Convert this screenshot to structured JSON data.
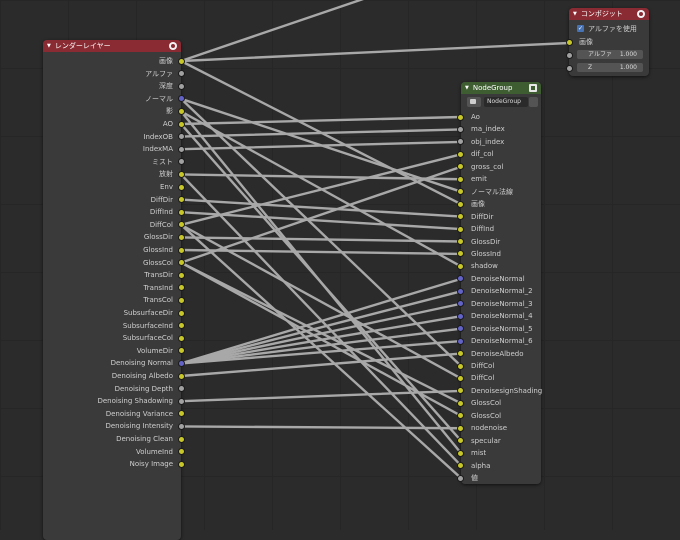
{
  "render_layers": {
    "title": "レンダーレイヤー",
    "outputs": [
      {
        "label": "画像",
        "c": "y"
      },
      {
        "label": "アルファ",
        "c": "g"
      },
      {
        "label": "深度",
        "c": "g"
      },
      {
        "label": "ノーマル",
        "c": "b"
      },
      {
        "label": "影",
        "c": "y"
      },
      {
        "label": "AO",
        "c": "y"
      },
      {
        "label": "IndexOB",
        "c": "g"
      },
      {
        "label": "IndexMA",
        "c": "g"
      },
      {
        "label": "ミスト",
        "c": "g"
      },
      {
        "label": "放射",
        "c": "y"
      },
      {
        "label": "Env",
        "c": "y"
      },
      {
        "label": "DiffDir",
        "c": "y"
      },
      {
        "label": "DiffInd",
        "c": "y"
      },
      {
        "label": "DiffCol",
        "c": "y"
      },
      {
        "label": "GlossDir",
        "c": "y"
      },
      {
        "label": "GlossInd",
        "c": "y"
      },
      {
        "label": "GlossCol",
        "c": "y"
      },
      {
        "label": "TransDir",
        "c": "y"
      },
      {
        "label": "TransInd",
        "c": "y"
      },
      {
        "label": "TransCol",
        "c": "y"
      },
      {
        "label": "SubsurfaceDir",
        "c": "y"
      },
      {
        "label": "SubsurfaceInd",
        "c": "y"
      },
      {
        "label": "SubsurfaceCol",
        "c": "y"
      },
      {
        "label": "VolumeDir",
        "c": "y"
      },
      {
        "label": "Denoising Normal",
        "c": "b"
      },
      {
        "label": "Denoising Albedo",
        "c": "y"
      },
      {
        "label": "Denoising Depth",
        "c": "g"
      },
      {
        "label": "Denoising Shadowing",
        "c": "g"
      },
      {
        "label": "Denoising Variance",
        "c": "y"
      },
      {
        "label": "Denoising Intensity",
        "c": "g"
      },
      {
        "label": "Denoising Clean",
        "c": "y"
      },
      {
        "label": "VolumeInd",
        "c": "y"
      },
      {
        "label": "Noisy Image",
        "c": "y"
      }
    ]
  },
  "composite": {
    "title": "コンポジット",
    "use_alpha_label": "アルファを使用",
    "image_label": "画像",
    "alpha_label": "アルファ",
    "alpha_value": "1.000",
    "z_label": "Z",
    "z_value": "1.000"
  },
  "node_group": {
    "title": "NodeGroup",
    "group_name": "NodeGroup",
    "inputs": [
      {
        "label": "Ao",
        "c": "y"
      },
      {
        "label": "ma_index",
        "c": "g"
      },
      {
        "label": "obj_index",
        "c": "g"
      },
      {
        "label": "dif_col",
        "c": "y"
      },
      {
        "label": "gross_col",
        "c": "y"
      },
      {
        "label": "emit",
        "c": "y"
      },
      {
        "label": "ノーマル法線",
        "c": "y"
      },
      {
        "label": "画像",
        "c": "y"
      },
      {
        "label": "DiffDir",
        "c": "y"
      },
      {
        "label": "DiffInd",
        "c": "y"
      },
      {
        "label": "GlossDir",
        "c": "y"
      },
      {
        "label": "GlossInd",
        "c": "y"
      },
      {
        "label": "shadow",
        "c": "y"
      },
      {
        "label": "DenoiseNormal",
        "c": "b"
      },
      {
        "label": "DenoiseNormal_2",
        "c": "b"
      },
      {
        "label": "DenoiseNormal_3",
        "c": "b"
      },
      {
        "label": "DenoiseNormal_4",
        "c": "b"
      },
      {
        "label": "DenoiseNormal_5",
        "c": "b"
      },
      {
        "label": "DenoiseNormal_6",
        "c": "b"
      },
      {
        "label": "DenoiseAlbedo",
        "c": "y"
      },
      {
        "label": "DiffCol",
        "c": "y"
      },
      {
        "label": "DiffCol",
        "c": "y"
      },
      {
        "label": "DenoisesignShading",
        "c": "y"
      },
      {
        "label": "GlossCol",
        "c": "y"
      },
      {
        "label": "GlossCol",
        "c": "y"
      },
      {
        "label": "nodenoise",
        "c": "y"
      },
      {
        "label": "specular",
        "c": "y"
      },
      {
        "label": "mist",
        "c": "y"
      },
      {
        "label": "alpha",
        "c": "y"
      },
      {
        "label": "値",
        "c": "g"
      }
    ]
  },
  "colors": {
    "background": "#2b2b2b",
    "link": "#a8a8a8",
    "socket_color": "#c7c729",
    "socket_gray": "#a1a1a1",
    "socket_vector": "#6363c7",
    "output_header": "#8a2b33",
    "group_header": "#3e5e32"
  },
  "links": [
    [
      0,
      7
    ],
    [
      0,
      "c0"
    ],
    [
      0,
      "up"
    ],
    [
      3,
      6
    ],
    [
      4,
      12
    ],
    [
      4,
      27
    ],
    [
      5,
      0
    ],
    [
      6,
      1
    ],
    [
      7,
      2
    ],
    [
      9,
      5
    ],
    [
      9,
      28
    ],
    [
      11,
      8
    ],
    [
      12,
      9
    ],
    [
      13,
      3
    ],
    [
      13,
      21
    ],
    [
      13,
      29
    ],
    [
      14,
      10
    ],
    [
      15,
      11
    ],
    [
      16,
      4
    ],
    [
      16,
      23
    ],
    [
      16,
      24
    ],
    [
      24,
      13
    ],
    [
      24,
      14
    ],
    [
      24,
      15
    ],
    [
      24,
      16
    ],
    [
      24,
      17
    ],
    [
      24,
      18
    ],
    [
      25,
      19
    ],
    [
      27,
      22
    ],
    [
      29,
      25
    ],
    [
      3,
      20
    ],
    [
      5,
      26
    ]
  ]
}
